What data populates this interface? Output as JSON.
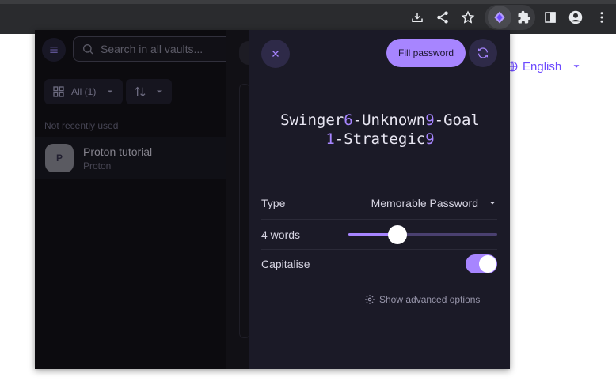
{
  "page": {
    "language": "English",
    "colors": {
      "accent": "#6d4aff",
      "brand_light": "#a785ff"
    }
  },
  "vault_list": {
    "search": {
      "placeholder": "Search in all vaults..."
    },
    "filter_label": "All (1)",
    "section_label": "Not recently used",
    "items": [
      {
        "title": "Proton tutorial",
        "subtitle": "Proton",
        "avatar_letter": "P"
      }
    ]
  },
  "generator": {
    "fill_button": "Fill password",
    "password_parts": [
      {
        "t": "Swinger",
        "digit": false
      },
      {
        "t": "6",
        "digit": true
      },
      {
        "t": "-Unknown",
        "digit": false
      },
      {
        "t": "9",
        "digit": true
      },
      {
        "t": "-Goal",
        "digit": false
      },
      {
        "t": "1",
        "digit": true
      },
      {
        "t": "-Strategic",
        "digit": false
      },
      {
        "t": "9",
        "digit": true
      }
    ],
    "type_label": "Type",
    "type_value": "Memorable Password",
    "words_label": "4 words",
    "words_slider_fraction": 0.33,
    "capitalise_label": "Capitalise",
    "capitalise_on": true,
    "advanced_label": "Show advanced options"
  }
}
